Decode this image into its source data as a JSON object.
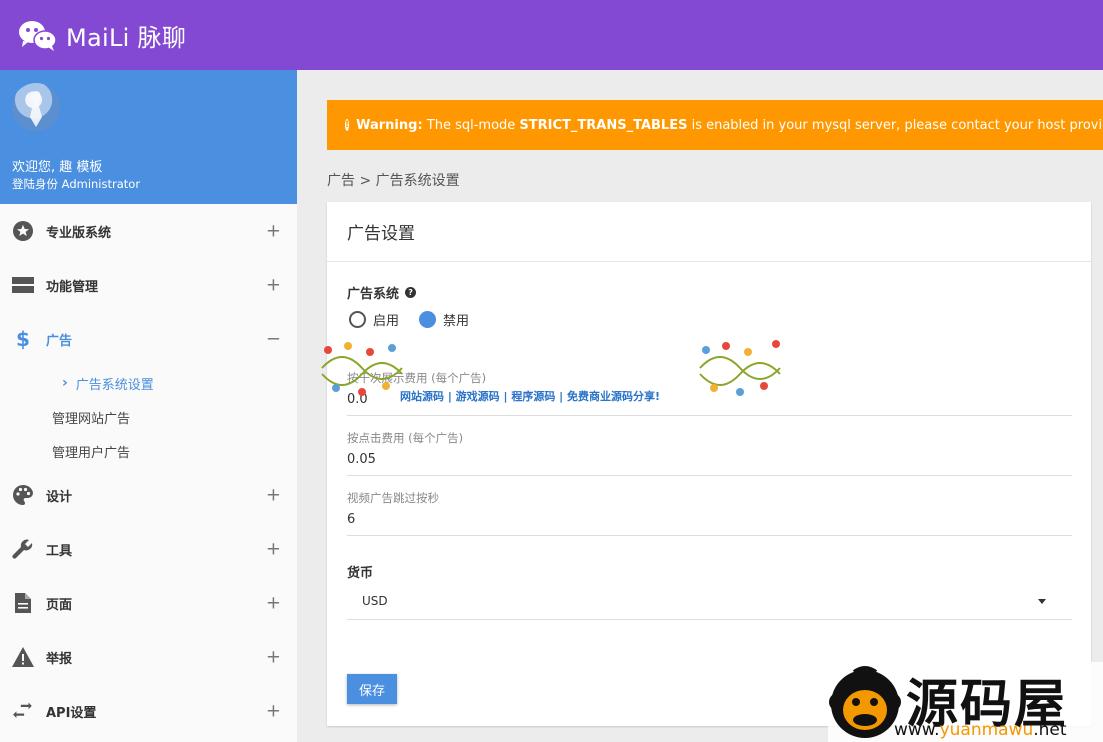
{
  "app": {
    "title": "MaiLi 脉聊"
  },
  "profile": {
    "welcome": "欢迎您, 趣 模板",
    "role": "登陆身份 Administrator"
  },
  "menu": [
    {
      "label": "专业版系统",
      "icon": "star-icon",
      "toggle": "+"
    },
    {
      "label": "功能管理",
      "icon": "server-icon",
      "toggle": "+"
    },
    {
      "label": "广告",
      "icon": "dollar-icon",
      "toggle": "−"
    },
    {
      "label": "设计",
      "icon": "palette-icon",
      "toggle": "+"
    },
    {
      "label": "工具",
      "icon": "wrench-icon",
      "toggle": "+"
    },
    {
      "label": "页面",
      "icon": "document-icon",
      "toggle": "+"
    },
    {
      "label": "举报",
      "icon": "warning-icon",
      "toggle": "+"
    },
    {
      "label": "API设置",
      "icon": "swap-icon",
      "toggle": "+"
    }
  ],
  "ads_submenu": [
    "广告系统设置",
    "管理网站广告",
    "管理用户广告"
  ],
  "warning": {
    "prefix": "Warning:",
    "text1": " The sql-mode ",
    "code": "STRICT_TRANS_TABLES",
    "text2": " is enabled in your mysql server, please contact your host provider to di"
  },
  "breadcrumb": "广告 > 广告系统设置",
  "card": {
    "title": "广告设置",
    "ad_system_label": "广告系统",
    "radio_enable": "启用",
    "radio_disable": "禁用",
    "fields": [
      {
        "label": "按千次展示费用 (每个广告)",
        "value": "0.0"
      },
      {
        "label": "按点击费用 (每个广告)",
        "value": "0.05"
      },
      {
        "label": "视频广告跳过按秒",
        "value": "6"
      }
    ],
    "currency_label": "货币",
    "currency_value": "USD",
    "save_label": "保存"
  },
  "watermark": {
    "line": "网站源码 | 游戏源码 | 程序源码 | 免费商业源码分享!",
    "brand": "源码屋",
    "url_pre": "www.",
    "url_mid": "yuanmawu",
    "url_post": ".net"
  },
  "colors": {
    "topbar": "#8449d3",
    "profile": "#4a8fe0",
    "warning": "#ff9800",
    "accent": "#4a8fe0"
  }
}
